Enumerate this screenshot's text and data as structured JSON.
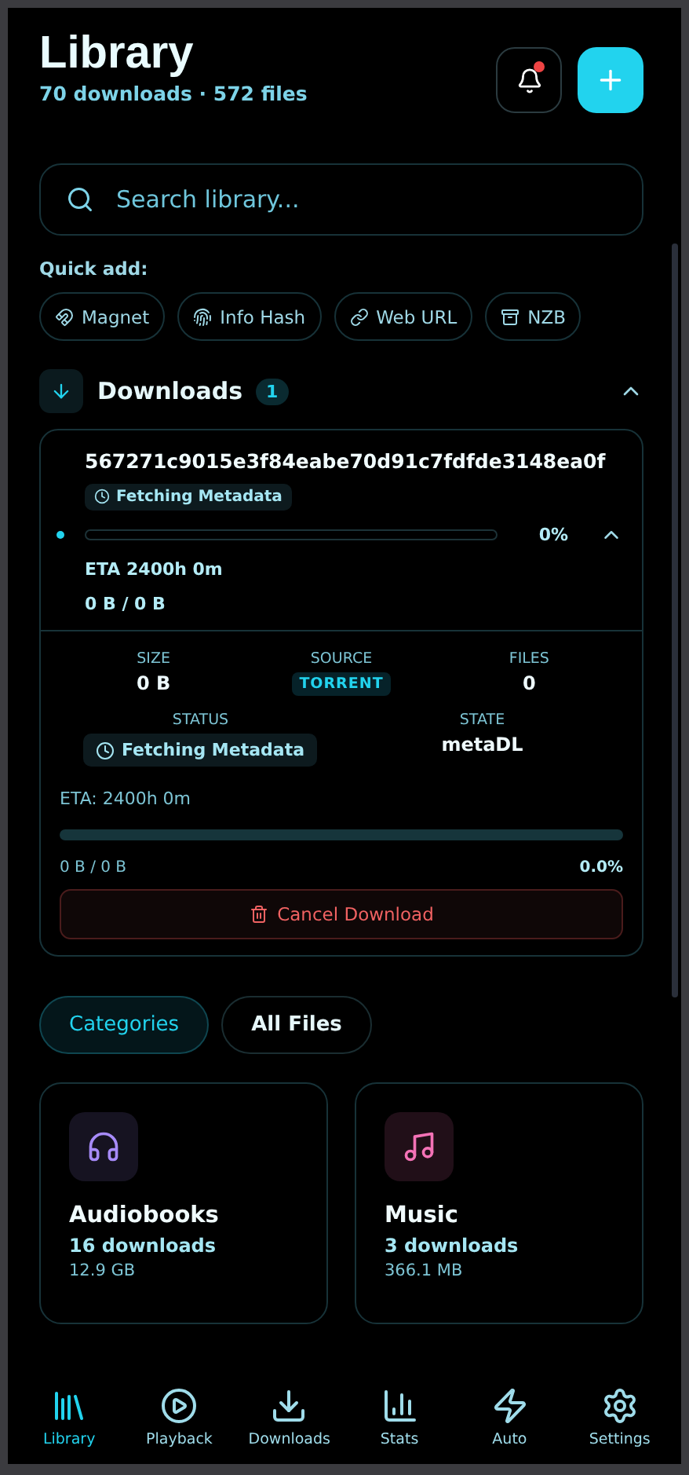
{
  "header": {
    "title": "Library",
    "subtitle": "70 downloads · 572 files",
    "has_notification": true
  },
  "search": {
    "placeholder": "Search library..."
  },
  "quick_add": {
    "label": "Quick add:",
    "items": [
      {
        "kind": "magnet",
        "label": "Magnet"
      },
      {
        "kind": "hash",
        "label": "Info Hash"
      },
      {
        "kind": "link",
        "label": "Web URL"
      },
      {
        "kind": "nzb",
        "label": "NZB"
      }
    ]
  },
  "downloads": {
    "title": "Downloads",
    "count": "1",
    "expanded": true,
    "items": [
      {
        "name": "567271c9015e3f84eabe70d91c7fdfde3148ea0f",
        "status": "Fetching Metadata",
        "level": 0,
        "percent": "0%",
        "eta": "ETA 2400h 0m",
        "transfer": "0 B / 0 B",
        "expanded": true,
        "details": {
          "size_label": "SIZE",
          "size": "0 B",
          "source_label": "SOURCE",
          "source": "TORRENT",
          "files_label": "FILES",
          "files": "0",
          "status_label": "STATUS",
          "status": "Fetching Metadata",
          "state_label": "STATE",
          "state": "metaDL",
          "eta": "ETA: 2400h 0m",
          "level": 0,
          "transfer": "0 B / 0 B",
          "percent": "0.0%",
          "cancel": "Cancel Download"
        }
      }
    ]
  },
  "view_tabs": [
    {
      "label": "Categories",
      "selected": true
    },
    {
      "label": "All Files",
      "selected": false
    }
  ],
  "categories": [
    {
      "kind": "audiobooks",
      "name": "Audiobooks",
      "count": "16 downloads",
      "size": "12.9 GB",
      "color": "#a78bfa"
    },
    {
      "kind": "music",
      "name": "Music",
      "count": "3 downloads",
      "size": "366.1 MB",
      "color": "#f472b6"
    }
  ],
  "nav": [
    {
      "kind": "library",
      "label": "Library",
      "selected": true
    },
    {
      "kind": "playback",
      "label": "Playback",
      "selected": false
    },
    {
      "kind": "downloads",
      "label": "Downloads",
      "selected": false
    },
    {
      "kind": "stats",
      "label": "Stats",
      "selected": false
    },
    {
      "kind": "auto",
      "label": "Auto",
      "selected": false
    },
    {
      "kind": "settings",
      "label": "Settings",
      "selected": false
    }
  ]
}
